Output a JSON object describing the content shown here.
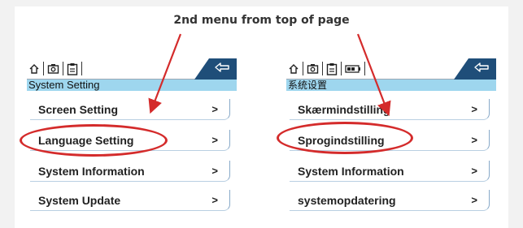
{
  "caption": "2nd menu from top of page",
  "left_panel": {
    "title": "System Setting",
    "items": [
      {
        "label": "Screen Setting",
        "chevron": ">"
      },
      {
        "label": "Language Setting",
        "chevron": ">"
      },
      {
        "label": "System Information",
        "chevron": ">"
      },
      {
        "label": "System Update",
        "chevron": ">"
      }
    ]
  },
  "right_panel": {
    "title": "系统设置",
    "items": [
      {
        "label": "Skærmindstilling",
        "chevron": ">"
      },
      {
        "label": "Sprogindstilling",
        "chevron": ">"
      },
      {
        "label": "System Information",
        "chevron": ">"
      },
      {
        "label": "systemopdatering",
        "chevron": ">"
      }
    ]
  },
  "icons": [
    "home-icon",
    "camera-icon",
    "clipboard-icon",
    "battery-icon",
    "back-arrow-icon"
  ],
  "colors": {
    "header_accent": "#1f4e79",
    "title_bar": "#9ed6ee",
    "highlight": "#d42b2b"
  }
}
